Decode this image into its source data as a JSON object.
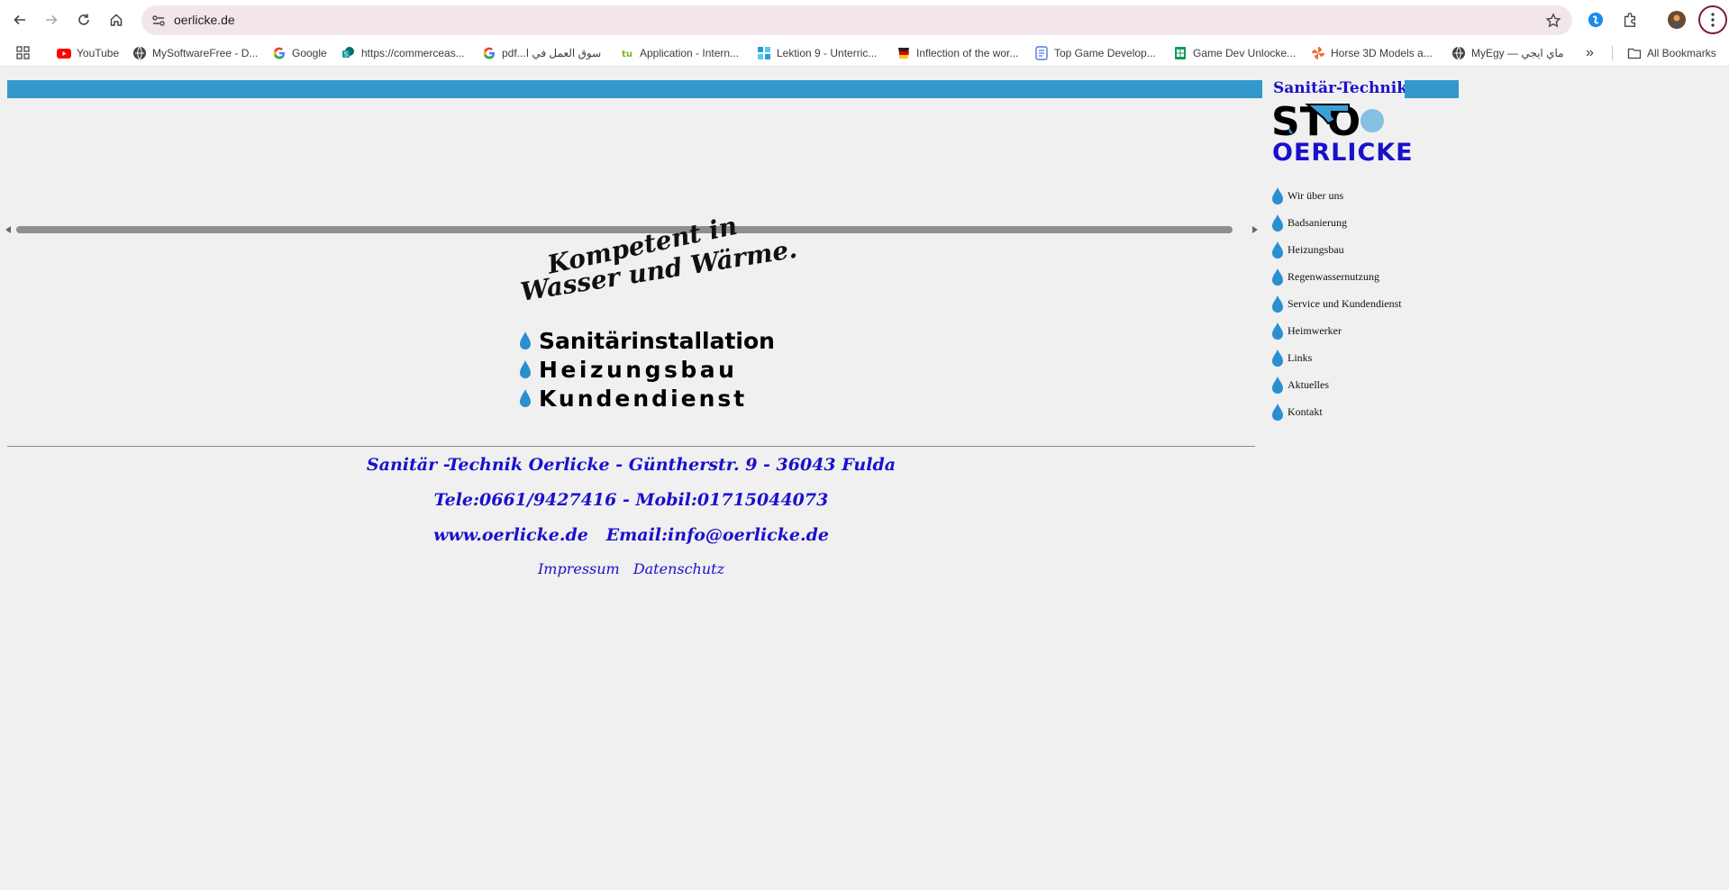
{
  "browser": {
    "url": "oerlicke.de",
    "bookmarks": [
      {
        "label": "YouTube",
        "icon": "youtube-icon"
      },
      {
        "label": "MySoftwareFree - D...",
        "icon": "globe-icon"
      },
      {
        "label": "Google",
        "icon": "google-icon"
      },
      {
        "label": "https://commerceas...",
        "icon": "sharepoint-icon"
      },
      {
        "label": "pdf...سوق العمل في ا",
        "icon": "google-icon"
      },
      {
        "label": "Application - Intern...",
        "icon": "tu-icon"
      },
      {
        "label": "Lektion 9 - Unterric...",
        "icon": "grid-icon"
      },
      {
        "label": "Inflection of the wor...",
        "icon": "flag-icon"
      },
      {
        "label": "Top Game Develop...",
        "icon": "doc-icon"
      },
      {
        "label": "Game Dev Unlocke...",
        "icon": "sheet-icon"
      },
      {
        "label": "Horse 3D Models a...",
        "icon": "pinwheel-icon"
      },
      {
        "label": "MyEgy — ماي ايجي",
        "icon": "globe-icon"
      }
    ],
    "all_bookmarks": "All Bookmarks",
    "more": "»"
  },
  "logo": {
    "title": "Sanitär-Technik",
    "mark": "STO",
    "city": "OERLICKE"
  },
  "menu": [
    "Wir über uns",
    "Badsanierung",
    "Heizungsbau",
    "Regenwassernutzung",
    "Service und Kundendienst",
    "Heimwerker",
    "Links",
    "Aktuelles",
    "Kontakt"
  ],
  "slogan": {
    "line1": "Kompetent in",
    "line2": "Wasser und Wärme.",
    "services": [
      "Sanitärinstallation",
      "Heizungsbau",
      "Kundendienst"
    ]
  },
  "contact": {
    "line1": "Sanitär -Technik Oerlicke - Güntherstr. 9 - 36043 Fulda",
    "line2": "Tele:0661/9427416 - Mobil:01715044073",
    "line3": "www.oerlicke.de   Email:info@oerlicke.de",
    "impressum": "Impressum",
    "datenschutz": "Datenschutz"
  },
  "colors": {
    "accent_bar": "#3399cc",
    "link_blue": "#1a10cc",
    "drop_blue": "#2a8fd0"
  }
}
